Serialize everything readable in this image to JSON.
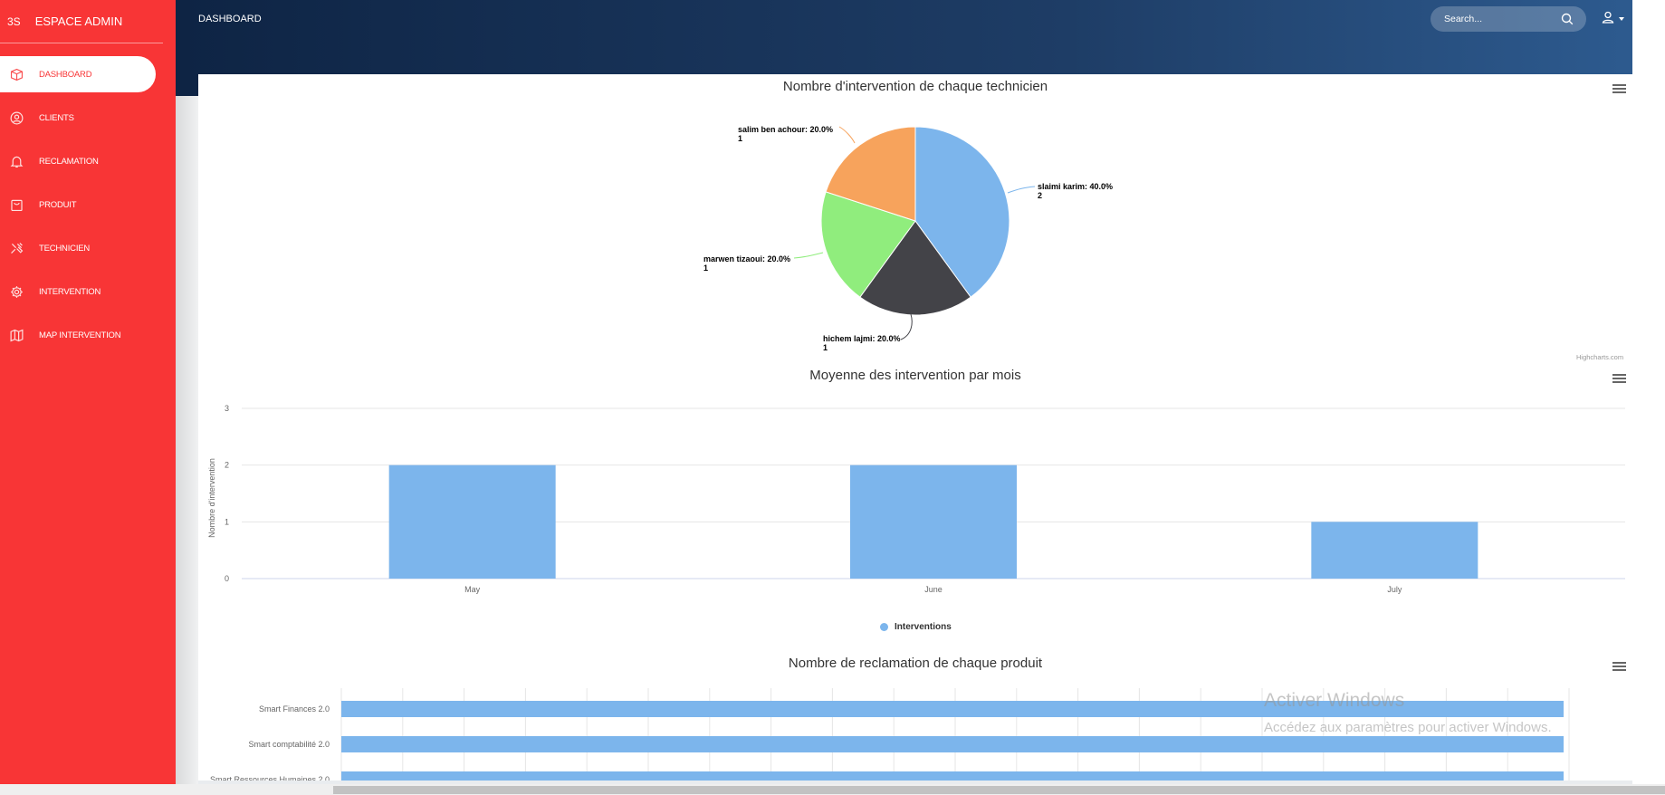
{
  "sidebar": {
    "brand_mini": "3S",
    "brand_title": "ESPACE ADMIN",
    "items": [
      {
        "label": "DASHBOARD",
        "icon": "box-icon",
        "active": true
      },
      {
        "label": "CLIENTS",
        "icon": "user-circle-icon"
      },
      {
        "label": "RECLAMATION",
        "icon": "bell-icon"
      },
      {
        "label": "PRODUIT",
        "icon": "bag-icon"
      },
      {
        "label": "TECHNICIEN",
        "icon": "tools-icon"
      },
      {
        "label": "INTERVENTION",
        "icon": "gear-icon"
      },
      {
        "label": "MAP INTERVENTION",
        "icon": "map-icon"
      }
    ]
  },
  "header": {
    "title": "DASHBOARD",
    "search_placeholder": "Search..."
  },
  "colors": {
    "sidebar": "#f83536",
    "bar": "#7cb5ec",
    "topbar_dark": "#0e2444"
  },
  "chart_data": [
    {
      "type": "pie",
      "title": "Nombre d'intervention de chaque technicien",
      "slices": [
        {
          "name": "slaimi karim",
          "percent": 40.0,
          "value": 2,
          "color": "#7cb5ec"
        },
        {
          "name": "hichem lajmi",
          "percent": 20.0,
          "value": 1,
          "color": "#434348"
        },
        {
          "name": "marwen tizaoui",
          "percent": 20.0,
          "value": 1,
          "color": "#90ed7d"
        },
        {
          "name": "salim ben achour",
          "percent": 20.0,
          "value": 1,
          "color": "#f7a35c"
        }
      ],
      "labels": [
        {
          "line1": "slaimi karim: 40.0%",
          "line2": "2"
        },
        {
          "line1": "hichem lajmi: 20.0%",
          "line2": "1"
        },
        {
          "line1": "marwen tizaoui: 20.0%",
          "line2": "1"
        },
        {
          "line1": "salim ben achour: 20.0%",
          "line2": "1"
        }
      ],
      "credits": "Highcharts.com"
    },
    {
      "type": "bar",
      "title": "Moyenne des intervention par mois",
      "categories": [
        "May",
        "June",
        "July"
      ],
      "series": [
        {
          "name": "Interventions",
          "values": [
            2,
            2,
            1
          ]
        }
      ],
      "ylabel": "Nombre d'intervention",
      "ylim": [
        0,
        3
      ],
      "yticks": [
        "0",
        "1",
        "2",
        "3"
      ],
      "grid": true,
      "legend": "bottom"
    },
    {
      "type": "bar",
      "orientation": "horizontal",
      "title": "Nombre de reclamation de chaque produit",
      "categories": [
        "Smart Finances 2.0",
        "Smart comptabilité 2.0",
        "Smart Ressources Humaines 2.0"
      ]
    }
  ],
  "watermark": {
    "line1": "Activer Windows",
    "line2": "Accédez aux paramètres pour activer Windows."
  }
}
